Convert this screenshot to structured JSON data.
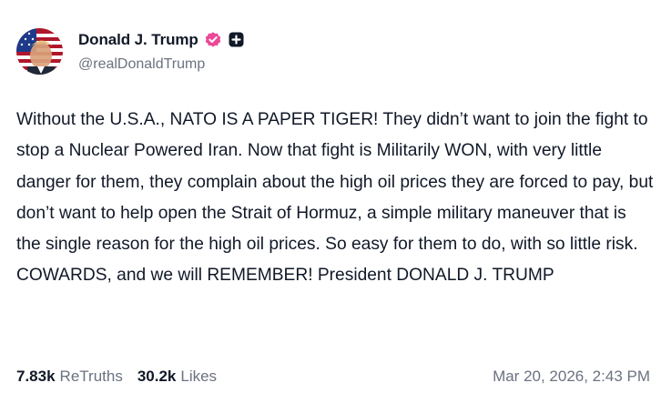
{
  "author": {
    "display_name": "Donald J. Trump",
    "handle": "@realDonaldTrump",
    "avatar_icon": "avatar-portrait-flag",
    "verified_icon": "verified-badge-icon",
    "verified_color": "#ec4899",
    "badge_icon": "plus-badge-icon"
  },
  "post": {
    "text": "Without the U.S.A., NATO IS A PAPER TIGER! They didn’t want to join the fight to stop a Nuclear Powered Iran. Now that fight is Militarily WON, with very little danger for them, they complain about the high oil prices they are forced to pay, but don’t want to help open the Strait of Hormuz, a simple military maneuver that is the single reason for the high oil prices. So easy for them to do, with so little risk. COWARDS, and we will REMEMBER! President DONALD J. TRUMP"
  },
  "stats": {
    "retruths_count": "7.83k",
    "retruths_label": "ReTruths",
    "likes_count": "30.2k",
    "likes_label": "Likes"
  },
  "timestamp": "Mar 20, 2026, 2:43 PM"
}
